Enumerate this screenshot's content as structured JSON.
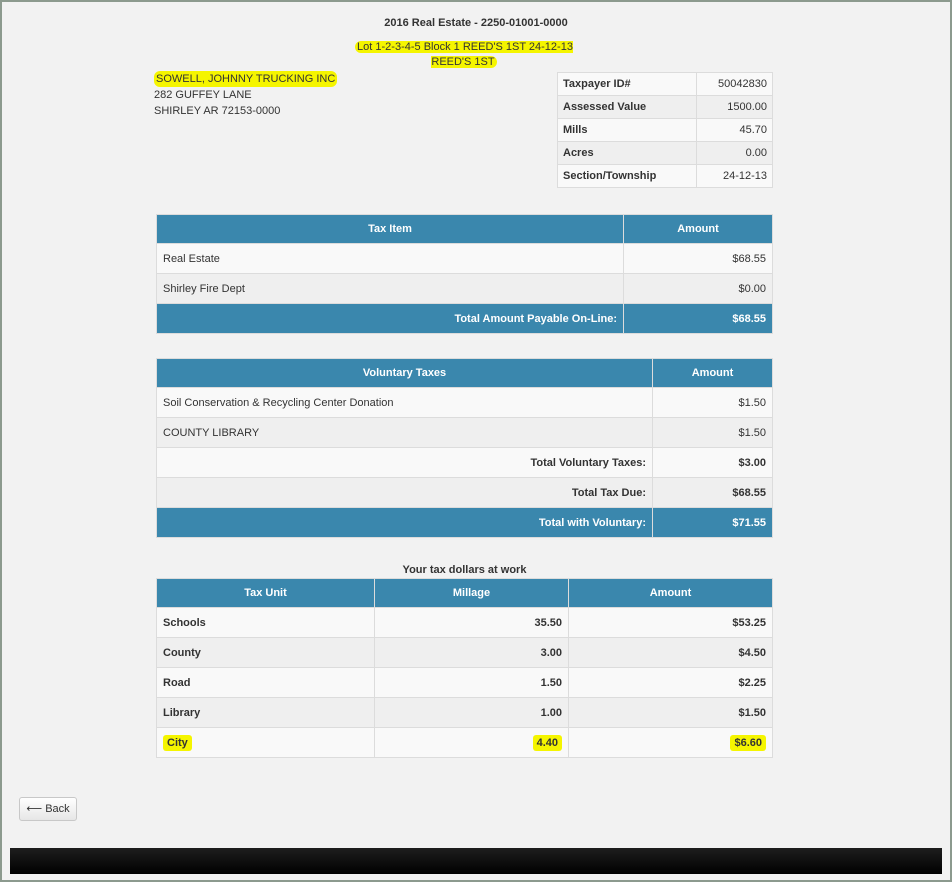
{
  "header": {
    "title": "2016 Real Estate - 2250-01001-0000",
    "legal_description": "Lot 1-2-3-4-5 Block 1 REED'S 1ST 24-12-13 REED'S 1ST"
  },
  "owner": {
    "name": "SOWELL, JOHNNY TRUCKING INC",
    "street": "282 GUFFEY LANE",
    "city_state_zip": "SHIRLEY AR 72153-0000"
  },
  "property": [
    {
      "label": "Taxpayer ID#",
      "value": "50042830"
    },
    {
      "label": "Assessed Value",
      "value": "1500.00"
    },
    {
      "label": "Mills",
      "value": "45.70"
    },
    {
      "label": "Acres",
      "value": "0.00"
    },
    {
      "label": "Section/Township",
      "value": "24-12-13"
    }
  ],
  "tax_items": {
    "headers": [
      "Tax Item",
      "Amount"
    ],
    "rows": [
      {
        "item": "Real Estate",
        "amount": "$68.55"
      },
      {
        "item": "Shirley Fire Dept",
        "amount": "$0.00"
      }
    ],
    "total_label": "Total Amount Payable On-Line:",
    "total_value": "$68.55"
  },
  "voluntary": {
    "headers": [
      "Voluntary Taxes",
      "Amount"
    ],
    "rows": [
      {
        "item": "Soil Conservation & Recycling Center Donation",
        "amount": "$1.50"
      },
      {
        "item": "COUNTY LIBRARY",
        "amount": "$1.50"
      }
    ],
    "total_voluntary_label": "Total Voluntary Taxes:",
    "total_voluntary_value": "$3.00",
    "total_tax_due_label": "Total Tax Due:",
    "total_tax_due_value": "$68.55",
    "total_with_voluntary_label": "Total with Voluntary:",
    "total_with_voluntary_value": "$71.55"
  },
  "work": {
    "title": "Your tax dollars at work",
    "headers": [
      "Tax Unit",
      "Millage",
      "Amount"
    ],
    "rows": [
      {
        "unit": "Schools",
        "millage": "35.50",
        "amount": "$53.25"
      },
      {
        "unit": "County",
        "millage": "3.00",
        "amount": "$4.50"
      },
      {
        "unit": "Road",
        "millage": "1.50",
        "amount": "$2.25"
      },
      {
        "unit": "Library",
        "millage": "1.00",
        "amount": "$1.50"
      },
      {
        "unit": "City",
        "millage": "4.40",
        "amount": "$6.60"
      }
    ]
  },
  "nav": {
    "back_icon": "left-arrow-icon",
    "back_arrow": "⟵",
    "back_label": "Back"
  },
  "colors": {
    "header_blue": "#3a87ad",
    "highlight": "#f5f500"
  }
}
